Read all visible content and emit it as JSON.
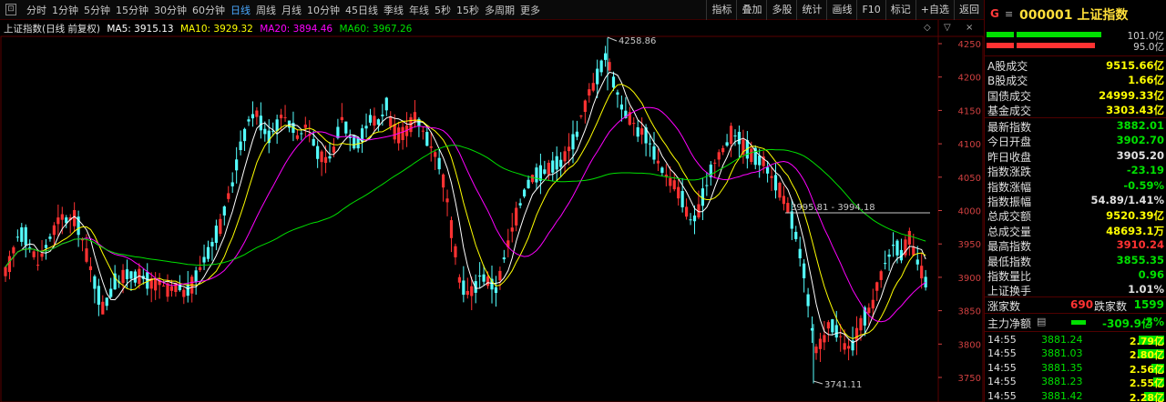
{
  "toolbar": {
    "periods": [
      "分时",
      "1分钟",
      "5分钟",
      "15分钟",
      "30分钟",
      "60分钟",
      "日线",
      "周线",
      "月线",
      "10分钟",
      "45日线",
      "季线",
      "年线",
      "5秒",
      "15秒",
      "多周期",
      "更多"
    ],
    "active_period": "日线",
    "tools": [
      "指标",
      "叠加",
      "多股",
      "统计",
      "画线",
      "F10",
      "标记",
      "+自选",
      "返回"
    ]
  },
  "legend": {
    "title": "上证指数(日线 前复权)",
    "ma5": "MA5: 3915.13",
    "ma10": "MA10: 3929.32",
    "ma20": "MA20: 3894.46",
    "ma60": "MA60: 3967.26",
    "ctrl_up": "◇",
    "ctrl_down": "▽",
    "ctrl_close": "×"
  },
  "colors": {
    "up": "#ff3232",
    "down": "#54ffff",
    "ma5": "#ffffff",
    "ma10": "#ffff00",
    "ma20": "#ff00ff",
    "ma60": "#00e000",
    "grid": "#5a0000",
    "axis_text": "#d04040",
    "panel_title": "#ffdf3a"
  },
  "chart_data": {
    "type": "candlestick",
    "ylim": [
      3725,
      4285
    ],
    "y_ticks": [
      3750,
      3800,
      3850,
      3900,
      3950,
      4000,
      4050,
      4100,
      4150,
      4200,
      4250
    ],
    "annotations": {
      "high": "4258.86",
      "low": "3741.11",
      "range_line": "3995.81 - 3994.18"
    }
  },
  "panel": {
    "g_icon": "G",
    "menu_icon": "≡",
    "code": "000001",
    "name": "上证指数",
    "bars": [
      {
        "value": "101.0亿",
        "color": "#00e000"
      },
      {
        "value": "95.0亿",
        "color": "#ff3232"
      }
    ],
    "section1": [
      {
        "label": "A股成交",
        "value": "9515.66亿",
        "color": "#ffff00"
      },
      {
        "label": "B股成交",
        "value": "1.66亿",
        "color": "#ffff00"
      },
      {
        "label": "国债成交",
        "value": "24999.33亿",
        "color": "#ffff00"
      },
      {
        "label": "基金成交",
        "value": "3303.43亿",
        "color": "#ffff00"
      }
    ],
    "section2": [
      {
        "label": "最新指数",
        "value": "3882.01",
        "color": "#00e000"
      },
      {
        "label": "今日开盘",
        "value": "3902.70",
        "color": "#00e000"
      },
      {
        "label": "昨日收盘",
        "value": "3905.20",
        "color": "#e0e0e0"
      },
      {
        "label": "指数涨跌",
        "value": "-23.19",
        "color": "#00e000"
      },
      {
        "label": "指数涨幅",
        "value": "-0.59%",
        "color": "#00e000"
      },
      {
        "label": "指数振幅",
        "value": "54.89/1.41%",
        "color": "#e0e0e0"
      },
      {
        "label": "总成交额",
        "value": "9520.39亿",
        "color": "#ffff00"
      },
      {
        "label": "总成交量",
        "value": "48693.1万",
        "color": "#ffff00"
      },
      {
        "label": "最高指数",
        "value": "3910.24",
        "color": "#ff3232"
      },
      {
        "label": "最低指数",
        "value": "3855.35",
        "color": "#00e000"
      },
      {
        "label": "指数量比",
        "value": "0.96",
        "color": "#00e000"
      },
      {
        "label": "上证换手",
        "value": "1.01%",
        "color": "#e0e0e0"
      }
    ],
    "breadth": {
      "up_label": "涨家数",
      "up_value": "690",
      "down_label": "跌家数",
      "down_value": "1599"
    },
    "mainflow": {
      "label": "主力净额",
      "icon": "▤",
      "value": "-309.9亿",
      "pct": "-3%"
    },
    "ticks": [
      {
        "time": "14:55",
        "price": "3881.24",
        "vol": "2.79亿",
        "bar": 0.7
      },
      {
        "time": "14:55",
        "price": "3881.03",
        "vol": "2.80亿",
        "bar": 0.72
      },
      {
        "time": "14:55",
        "price": "3881.35",
        "vol": "2.56亿",
        "bar": 0.35
      },
      {
        "time": "14:55",
        "price": "3881.23",
        "vol": "2.55亿",
        "bar": 0.3
      },
      {
        "time": "14:55",
        "price": "3881.42",
        "vol": "2.28亿",
        "bar": 0.55
      }
    ]
  }
}
